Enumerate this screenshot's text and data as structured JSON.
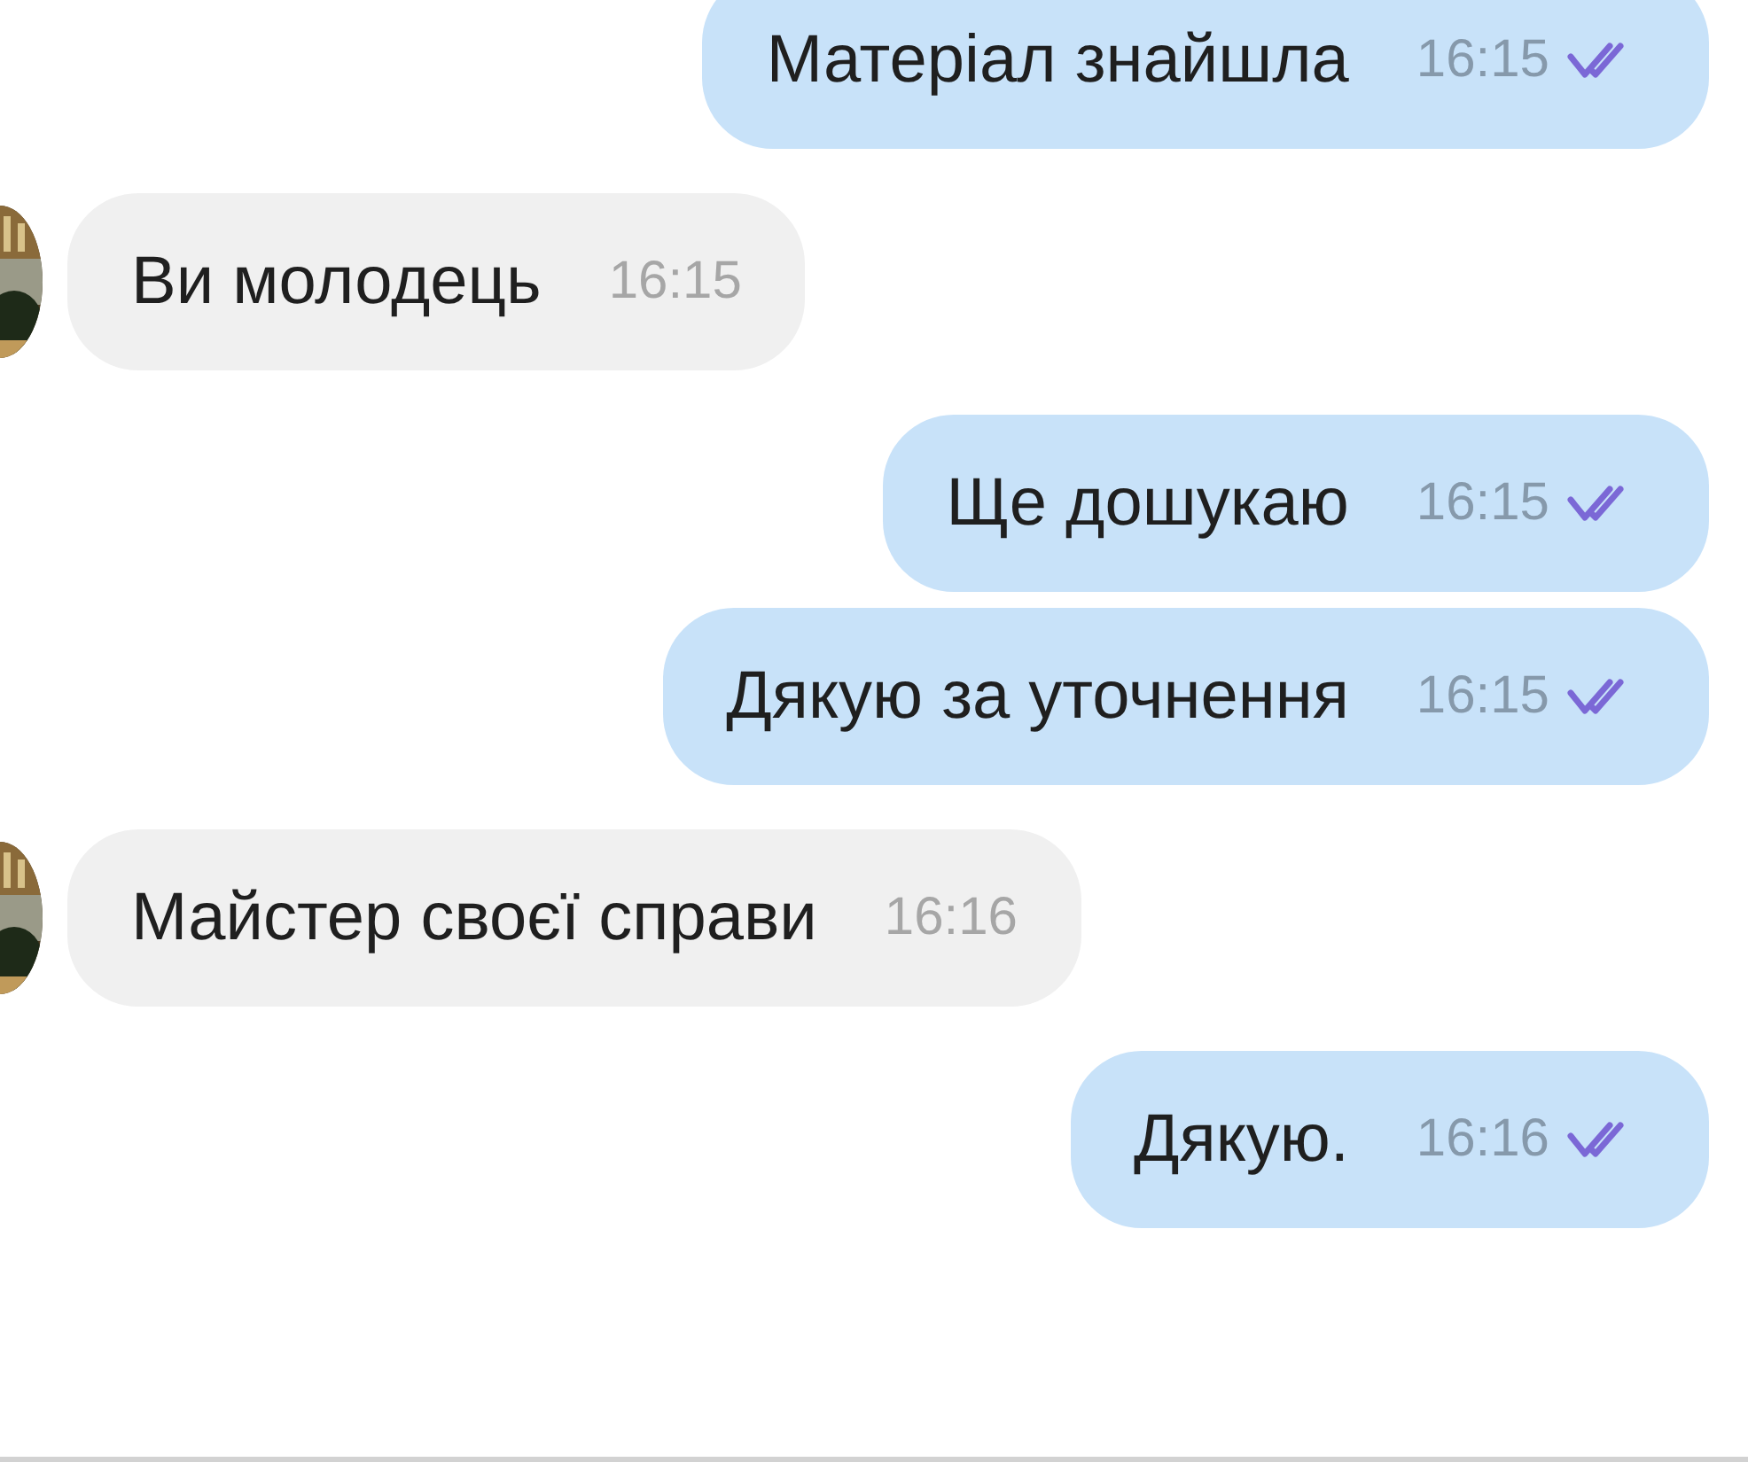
{
  "messages": [
    {
      "kind": "out",
      "text": "Матеріал знайшла",
      "time": "16:15",
      "read": true
    },
    {
      "kind": "in",
      "text": "Ви молодець",
      "time": "16:15"
    },
    {
      "kind": "out",
      "text": "Ще дошукаю",
      "time": "16:15",
      "read": true
    },
    {
      "kind": "out",
      "text": "Дякую за уточнення",
      "time": "16:15",
      "read": true
    },
    {
      "kind": "in",
      "text": "Майстер своєї справи",
      "time": "16:16"
    },
    {
      "kind": "out",
      "text": "Дякую.",
      "time": "16:16",
      "read": true
    }
  ]
}
